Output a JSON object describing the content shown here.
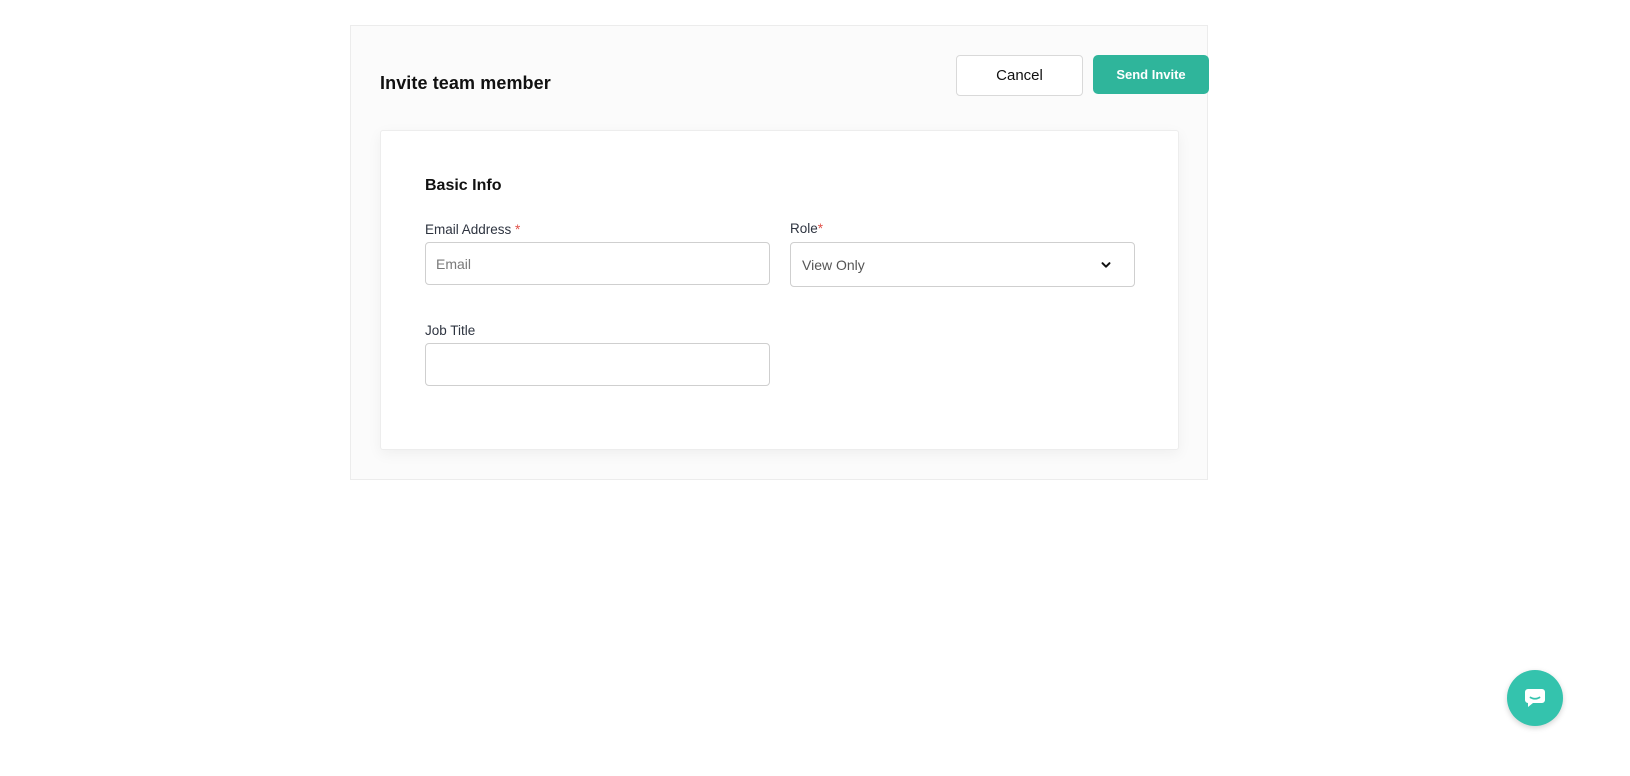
{
  "header": {
    "title": "Invite team member",
    "cancel_label": "Cancel",
    "send_label": "Send Invite"
  },
  "form": {
    "section_title": "Basic Info",
    "email": {
      "label": "Email Address ",
      "required_mark": "*",
      "placeholder": "Email",
      "value": ""
    },
    "role": {
      "label": "Role",
      "required_mark": "*",
      "selected": "View Only"
    },
    "job_title": {
      "label": "Job Title",
      "value": ""
    }
  },
  "chat": {
    "icon": "chat-bubble-icon"
  },
  "colors": {
    "accent": "#2fb59b",
    "chat_fab": "#34c3ad",
    "required": "#e0524a"
  }
}
